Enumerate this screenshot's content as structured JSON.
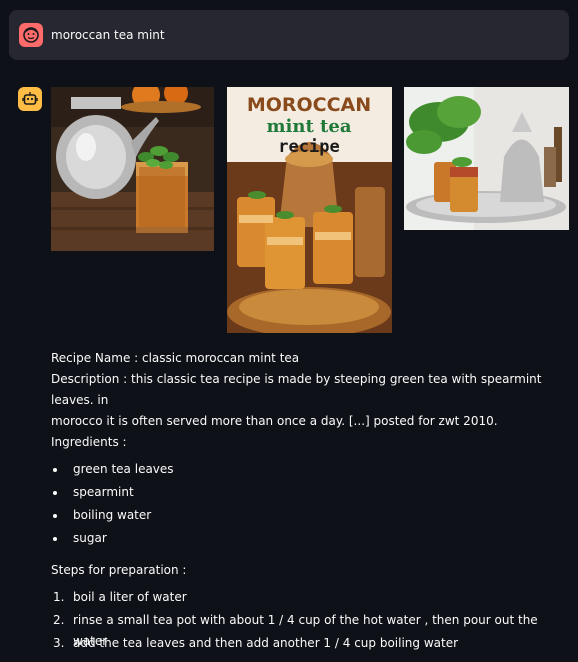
{
  "user_message": {
    "text": "moroccan tea mint"
  },
  "images": [
    {
      "alt": "silver teapot with glass of mint tea"
    },
    {
      "alt": "moroccan mint tea recipe",
      "title_lines": [
        "MOROCCAN",
        "mint tea",
        "recipe"
      ]
    },
    {
      "alt": "mint tea glasses on silver tray"
    }
  ],
  "recipe": {
    "name_line": "Recipe Name : classic moroccan mint tea",
    "description_line1": "Description : this classic tea recipe is made by steeping green tea with spearmint leaves. in",
    "description_line2": "morocco it is often served more than once a day. [...] posted for zwt 2010.",
    "ingredients_label": "Ingredients :",
    "ingredients": [
      "green tea leaves",
      "spearmint",
      "boiling water",
      "sugar"
    ],
    "steps_label": "Steps for preparation :",
    "steps": [
      {
        "num": "1.",
        "text": "boil a liter of water"
      },
      {
        "num": "2.",
        "text": "rinse a small tea pot with about 1 / 4 cup of the hot water , then pour out the water"
      },
      {
        "num": "3.",
        "text": "add the tea leaves and then add another 1 / 4 cup boiling water"
      }
    ]
  },
  "colors": {
    "user_avatar": "#ff6b6b",
    "bot_avatar": "#ffbd45",
    "background": "#0e1117",
    "user_bubble": "#262730"
  }
}
